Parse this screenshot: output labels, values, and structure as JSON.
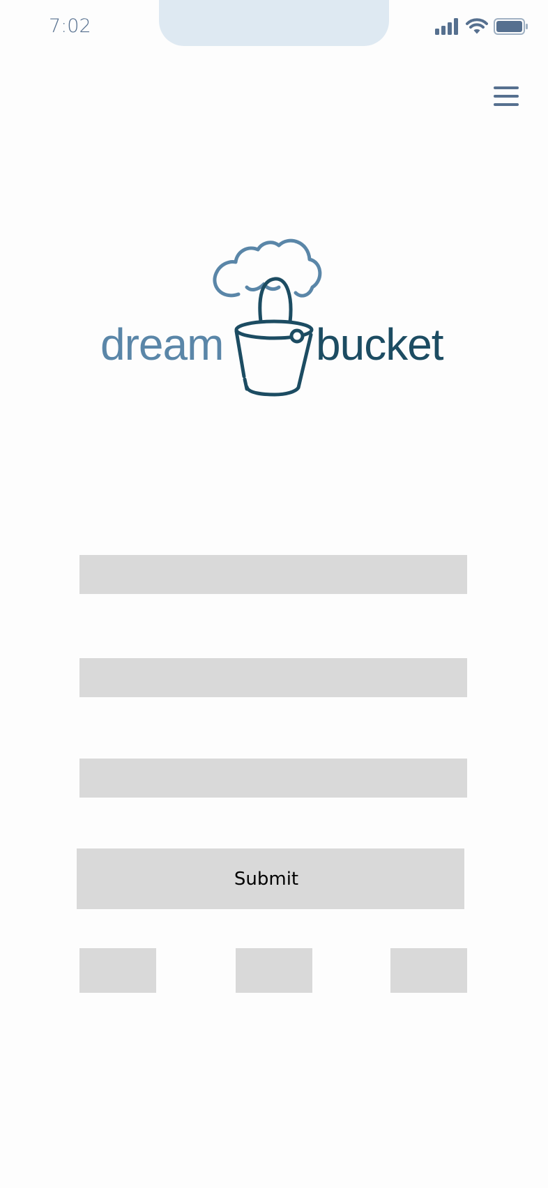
{
  "status_bar": {
    "time": "7:02",
    "icons": [
      "signal-icon",
      "wifi-icon",
      "battery-icon"
    ]
  },
  "header": {
    "menu_icon": "hamburger-menu-icon"
  },
  "logo": {
    "word_left": "dream",
    "word_right": "bucket",
    "colors": {
      "light": "#5a86a8",
      "dark": "#1c4c62"
    }
  },
  "form": {
    "fields": [
      {
        "value": "",
        "placeholder": ""
      },
      {
        "value": "",
        "placeholder": ""
      },
      {
        "value": "",
        "placeholder": ""
      }
    ],
    "submit_label": "Submit",
    "secondary_buttons": [
      {
        "label": ""
      },
      {
        "label": ""
      },
      {
        "label": ""
      }
    ]
  },
  "colors": {
    "placeholder_gray": "#d9d9d9",
    "status_text": "#56708f",
    "notch": "#dee9f2"
  }
}
